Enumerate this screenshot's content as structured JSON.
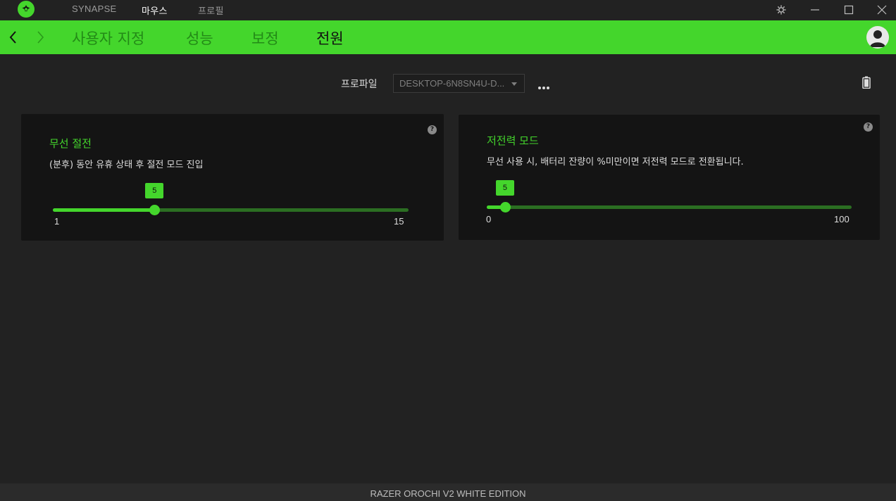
{
  "titlebar": {
    "tabs": [
      {
        "label": "SYNAPSE",
        "active": false
      },
      {
        "label": "마우스",
        "active": true
      },
      {
        "label": "프로필",
        "active": false
      }
    ],
    "icons": [
      "settings-icon",
      "minimize-icon",
      "maximize-icon",
      "close-icon"
    ]
  },
  "nav": {
    "tabs": [
      {
        "label": "사용자 지정",
        "active": false
      },
      {
        "label": "성능",
        "active": false
      },
      {
        "label": "보정",
        "active": false
      },
      {
        "label": "전원",
        "active": true
      }
    ]
  },
  "profile": {
    "label": "프로파일",
    "selected": "DESKTOP-6N8SN4U-D..."
  },
  "sleep_card": {
    "title": "무선 절전",
    "description": "(분후) 동안 유휴 상태 후 절전 모드 진입",
    "help": "?",
    "slider": {
      "min": 1,
      "max": 15,
      "value": 5,
      "min_label": "1",
      "max_label": "15",
      "value_label": "5"
    }
  },
  "power_card": {
    "title": "저전력 모드",
    "description": "무선 사용 시, 배터리 잔량이 %미만이면 저전력 모드로 전환됩니다.",
    "help": "?",
    "slider": {
      "min": 0,
      "max": 100,
      "value": 5,
      "min_label": "0",
      "max_label": "100",
      "value_label": "5"
    }
  },
  "footer": {
    "device_name": "RAZER OROCHI V2 WHITE EDITION"
  },
  "colors": {
    "accent": "#44d62c",
    "background": "#222222",
    "card": "#141414"
  }
}
